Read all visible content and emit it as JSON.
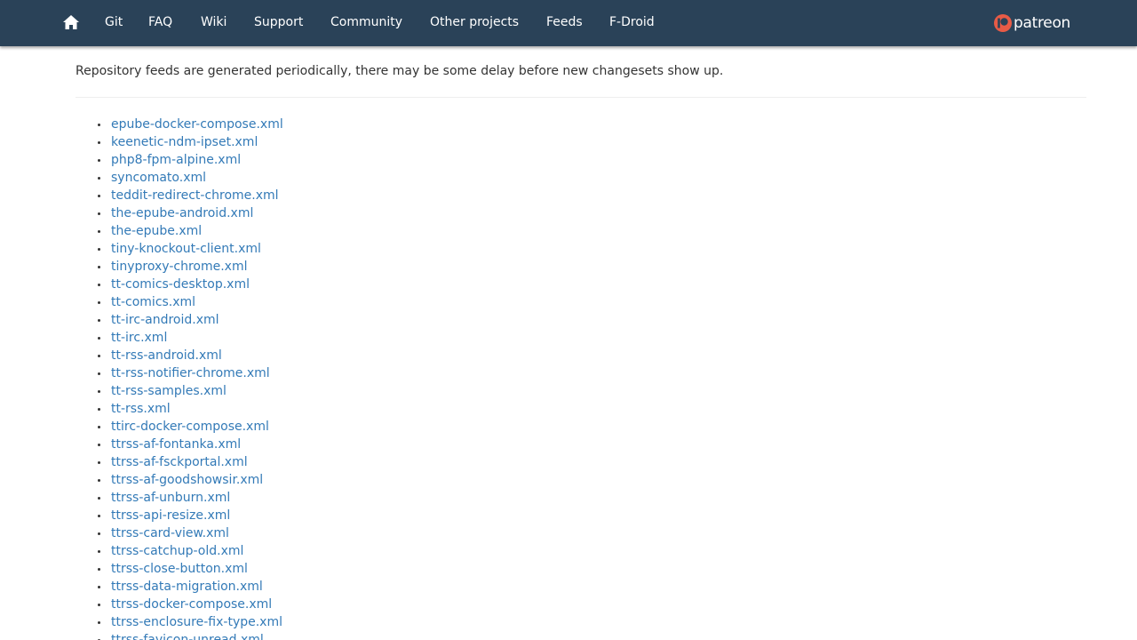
{
  "nav": {
    "home_icon": "home-icon",
    "links": [
      "Git",
      "FAQ",
      "Wiki",
      "Support",
      "Community",
      "Other projects",
      "Feeds",
      "F-Droid"
    ],
    "patreon": {
      "icon": "patreon-icon",
      "label": "patreon"
    },
    "colors": {
      "bar": "#2a4258",
      "text": "#ffffff"
    }
  },
  "notice": "Repository feeds are generated periodically, there may be some delay before new changesets show up.",
  "feeds": [
    "epube-docker-compose.xml",
    "keenetic-ndm-ipset.xml",
    "php8-fpm-alpine.xml",
    "syncomato.xml",
    "teddit-redirect-chrome.xml",
    "the-epube-android.xml",
    "the-epube.xml",
    "tiny-knockout-client.xml",
    "tinyproxy-chrome.xml",
    "tt-comics-desktop.xml",
    "tt-comics.xml",
    "tt-irc-android.xml",
    "tt-irc.xml",
    "tt-rss-android.xml",
    "tt-rss-notifier-chrome.xml",
    "tt-rss-samples.xml",
    "tt-rss.xml",
    "ttirc-docker-compose.xml",
    "ttrss-af-fontanka.xml",
    "ttrss-af-fsckportal.xml",
    "ttrss-af-goodshowsir.xml",
    "ttrss-af-unburn.xml",
    "ttrss-api-resize.xml",
    "ttrss-card-view.xml",
    "ttrss-catchup-old.xml",
    "ttrss-close-button.xml",
    "ttrss-data-migration.xml",
    "ttrss-docker-compose.xml",
    "ttrss-enclosure-fix-type.xml",
    "ttrss-favicon-unread.xml"
  ],
  "colors": {
    "link": "#337ab7",
    "text": "#333333"
  }
}
